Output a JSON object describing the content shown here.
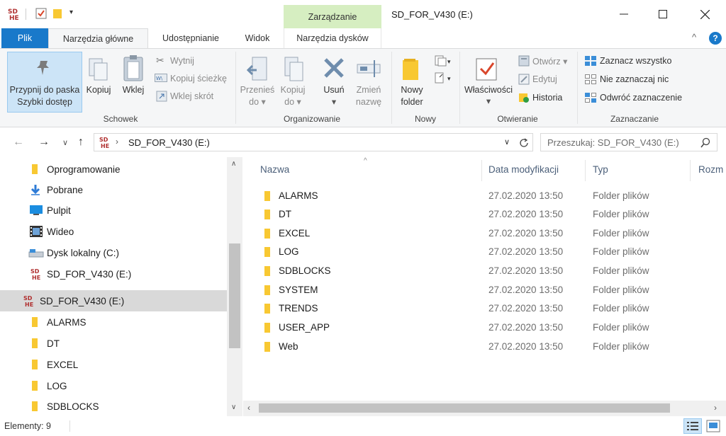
{
  "titlebar": {
    "context_group": "Zarządzanie",
    "title": "SD_FOR_V430 (E:)"
  },
  "tabs": {
    "file": "Plik",
    "home": "Narzędzia główne",
    "share": "Udostępnianie",
    "view": "Widok",
    "disk_tools": "Narzędzia dysków"
  },
  "ribbon": {
    "pin_line1": "Przypnij do paska",
    "pin_line2": "Szybki dostęp",
    "copy": "Kopiuj",
    "paste": "Wklej",
    "cut": "Wytnij",
    "copy_path": "Kopiuj ścieżkę",
    "paste_shortcut": "Wklej skrót",
    "group_clipboard": "Schowek",
    "move_to_1": "Przenieś",
    "move_to_2": "do",
    "copy_to_1": "Kopiuj",
    "copy_to_2": "do",
    "delete": "Usuń",
    "rename_1": "Zmień",
    "rename_2": "nazwę",
    "group_organize": "Organizowanie",
    "new_folder_1": "Nowy",
    "new_folder_2": "folder",
    "group_new": "Nowy",
    "properties": "Właściwości",
    "open": "Otwórz",
    "edit": "Edytuj",
    "history": "Historia",
    "group_open": "Otwieranie",
    "select_all": "Zaznacz wszystko",
    "select_none": "Nie zaznaczaj nic",
    "invert_selection": "Odwróć zaznaczenie",
    "group_select": "Zaznaczanie"
  },
  "address": {
    "path": "SD_FOR_V430 (E:)",
    "search_placeholder": "Przeszukaj: SD_FOR_V430 (E:)"
  },
  "nav": {
    "items": [
      {
        "label": "Oprogramowanie",
        "icon": "folder-icon"
      },
      {
        "label": "Pobrane",
        "icon": "download-icon"
      },
      {
        "label": "Pulpit",
        "icon": "desktop-icon"
      },
      {
        "label": "Wideo",
        "icon": "video-icon"
      },
      {
        "label": "Dysk lokalny (C:)",
        "icon": "drive-icon"
      },
      {
        "label": "SD_FOR_V430 (E:)",
        "icon": "sd-drive-icon"
      },
      {
        "label": "SD_FOR_V430 (E:)",
        "icon": "sd-drive-icon"
      },
      {
        "label": "ALARMS",
        "icon": "folder-icon"
      },
      {
        "label": "DT",
        "icon": "folder-icon"
      },
      {
        "label": "EXCEL",
        "icon": "folder-icon"
      },
      {
        "label": "LOG",
        "icon": "folder-icon"
      },
      {
        "label": "SDBLOCKS",
        "icon": "folder-icon"
      }
    ]
  },
  "columns": {
    "name": "Nazwa",
    "date": "Data modyfikacji",
    "type": "Typ",
    "size": "Rozm"
  },
  "files": [
    {
      "name": "ALARMS",
      "date": "27.02.2020 13:50",
      "type": "Folder plików"
    },
    {
      "name": "DT",
      "date": "27.02.2020 13:50",
      "type": "Folder plików"
    },
    {
      "name": "EXCEL",
      "date": "27.02.2020 13:50",
      "type": "Folder plików"
    },
    {
      "name": "LOG",
      "date": "27.02.2020 13:50",
      "type": "Folder plików"
    },
    {
      "name": "SDBLOCKS",
      "date": "27.02.2020 13:50",
      "type": "Folder plików"
    },
    {
      "name": "SYSTEM",
      "date": "27.02.2020 13:50",
      "type": "Folder plików"
    },
    {
      "name": "TRENDS",
      "date": "27.02.2020 13:50",
      "type": "Folder plików"
    },
    {
      "name": "USER_APP",
      "date": "27.02.2020 13:50",
      "type": "Folder plików"
    },
    {
      "name": "Web",
      "date": "27.02.2020 13:50",
      "type": "Folder plików"
    }
  ],
  "status": {
    "count": "Elementy: 9"
  },
  "colors": {
    "accent": "#1979ca",
    "context_tab": "#d6eec1",
    "selection": "#cce4f7",
    "folder": "#f8c832"
  }
}
